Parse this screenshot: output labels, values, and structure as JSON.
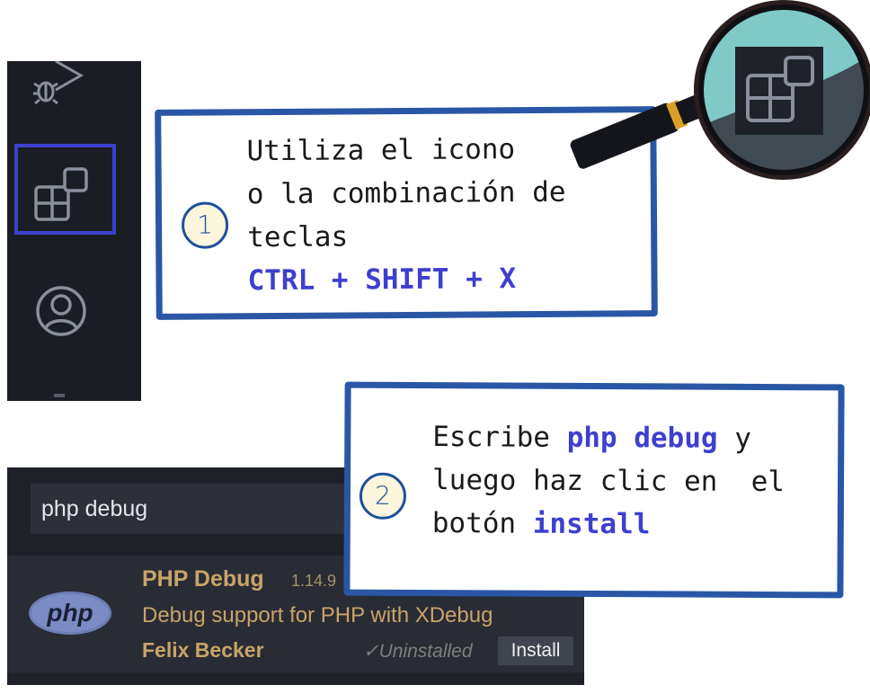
{
  "activity_bar": {
    "icons": [
      "debug-icon",
      "extensions-icon",
      "account-icon"
    ]
  },
  "callout_1": {
    "step": "1",
    "line1": "Utiliza el icono",
    "line2": "o la combinación de",
    "line3": "teclas",
    "shortcut": "CTRL + SHIFT + X"
  },
  "callout_2": {
    "step": "2",
    "line1_pre": "Escribe ",
    "line1_hl": "php debug",
    "line1_post": " y",
    "line2": "luego haz clic en  el",
    "line3_pre": "botón ",
    "line3_hl": "install"
  },
  "extensions_panel": {
    "search_value": "php debug",
    "result": {
      "logo_text": "php",
      "name": "PHP Debug",
      "version": "1.14.9",
      "description": "Debug support for PHP with XDebug",
      "author": "Felix Becker",
      "status": "Uninstalled",
      "install_label": "Install"
    }
  },
  "colors": {
    "highlight": "#3d3fcf",
    "callout_border": "#2a56a6",
    "activity_bg": "#1b1d24",
    "extension_text": "#c8a46a"
  }
}
